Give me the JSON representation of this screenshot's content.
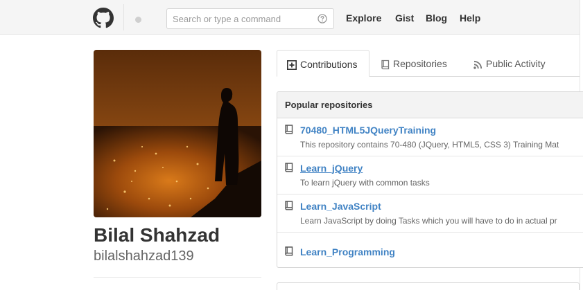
{
  "header": {
    "search": {
      "placeholder": "Search or type a command"
    },
    "nav": [
      "Explore",
      "Gist",
      "Blog",
      "Help"
    ]
  },
  "profile": {
    "full_name": "Bilal Shahzad",
    "username": "bilalshahzad139"
  },
  "tabs": [
    {
      "label": "Contributions",
      "icon": "plus-square-icon",
      "selected": true
    },
    {
      "label": "Repositories",
      "icon": "book-icon",
      "selected": false
    },
    {
      "label": "Public Activity",
      "icon": "rss-icon",
      "selected": false
    }
  ],
  "popular": {
    "title": "Popular repositories",
    "repos": [
      {
        "name": "70480_HTML5JQueryTraining",
        "description": "This repository contains 70-480 (JQuery, HTML5, CSS 3) Training Mat"
      },
      {
        "name": "Learn_jQuery",
        "description": "To learn jQuery with common tasks"
      },
      {
        "name": "Learn_JavaScript",
        "description": "Learn JavaScript by doing Tasks which you will have to do in actual pr"
      },
      {
        "name": "Learn_Programming",
        "description": ""
      }
    ]
  },
  "colors": {
    "link": "#4183c4",
    "header_bg": "#f5f5f5"
  }
}
